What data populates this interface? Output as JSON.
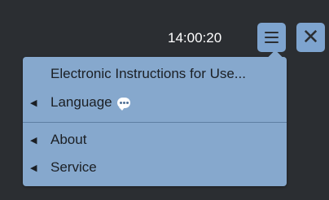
{
  "header": {
    "time": "14:00:20",
    "menu_icon": "hamburger-icon",
    "close_icon": "close-icon",
    "close_glyph": "✕"
  },
  "menu": {
    "items": [
      {
        "label": "Electronic Instructions for Use...",
        "submenu": false
      },
      {
        "label": "Language",
        "submenu": true,
        "icon": "speech-bubble-icon"
      },
      {
        "label": "About",
        "submenu": true
      },
      {
        "label": "Service",
        "submenu": true
      }
    ]
  },
  "colors": {
    "background": "#2b2e32",
    "button": "#7ea4cf",
    "menu": "#86a8cd",
    "text": "#1b1f24"
  }
}
